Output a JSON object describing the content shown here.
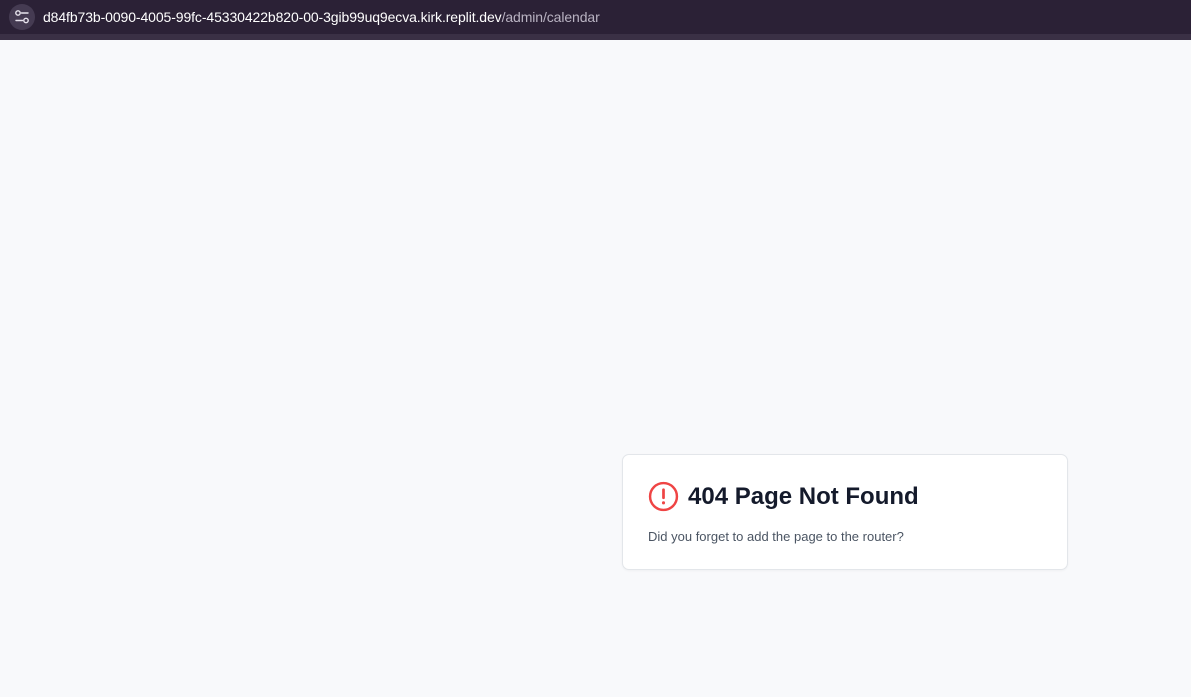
{
  "browser": {
    "url_host": "d84fb73b-0090-4005-99fc-45330422b820-00-3gib99uq9ecva.kirk.replit.dev",
    "url_path": "/admin/calendar",
    "site_info_icon": "tune-icon"
  },
  "not_found": {
    "icon": "alert-circle-icon",
    "title": "404 Page Not Found",
    "message": "Did you forget to add the page to the router?",
    "accent_color": "#ef4444"
  },
  "colors": {
    "browser_bar": "#2b2136",
    "page_background": "#f8f9fb",
    "card_background": "#ffffff",
    "title_text": "#141a2b",
    "body_text": "#4b5563"
  }
}
